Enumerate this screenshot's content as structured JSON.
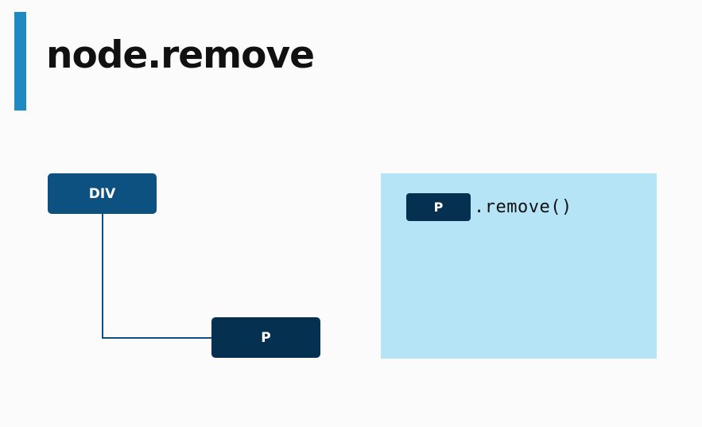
{
  "slide": {
    "title": "node.remove",
    "accent_color": "#1f8ac2"
  },
  "tree": {
    "parent": {
      "label": "DIV",
      "color": "#0d5181"
    },
    "child": {
      "label": "P",
      "color": "#05304f"
    },
    "connector_color": "#0d5181"
  },
  "code_panel": {
    "background_color": "#b5e4f7",
    "chip_label": "P",
    "method_text": ".remove()"
  }
}
